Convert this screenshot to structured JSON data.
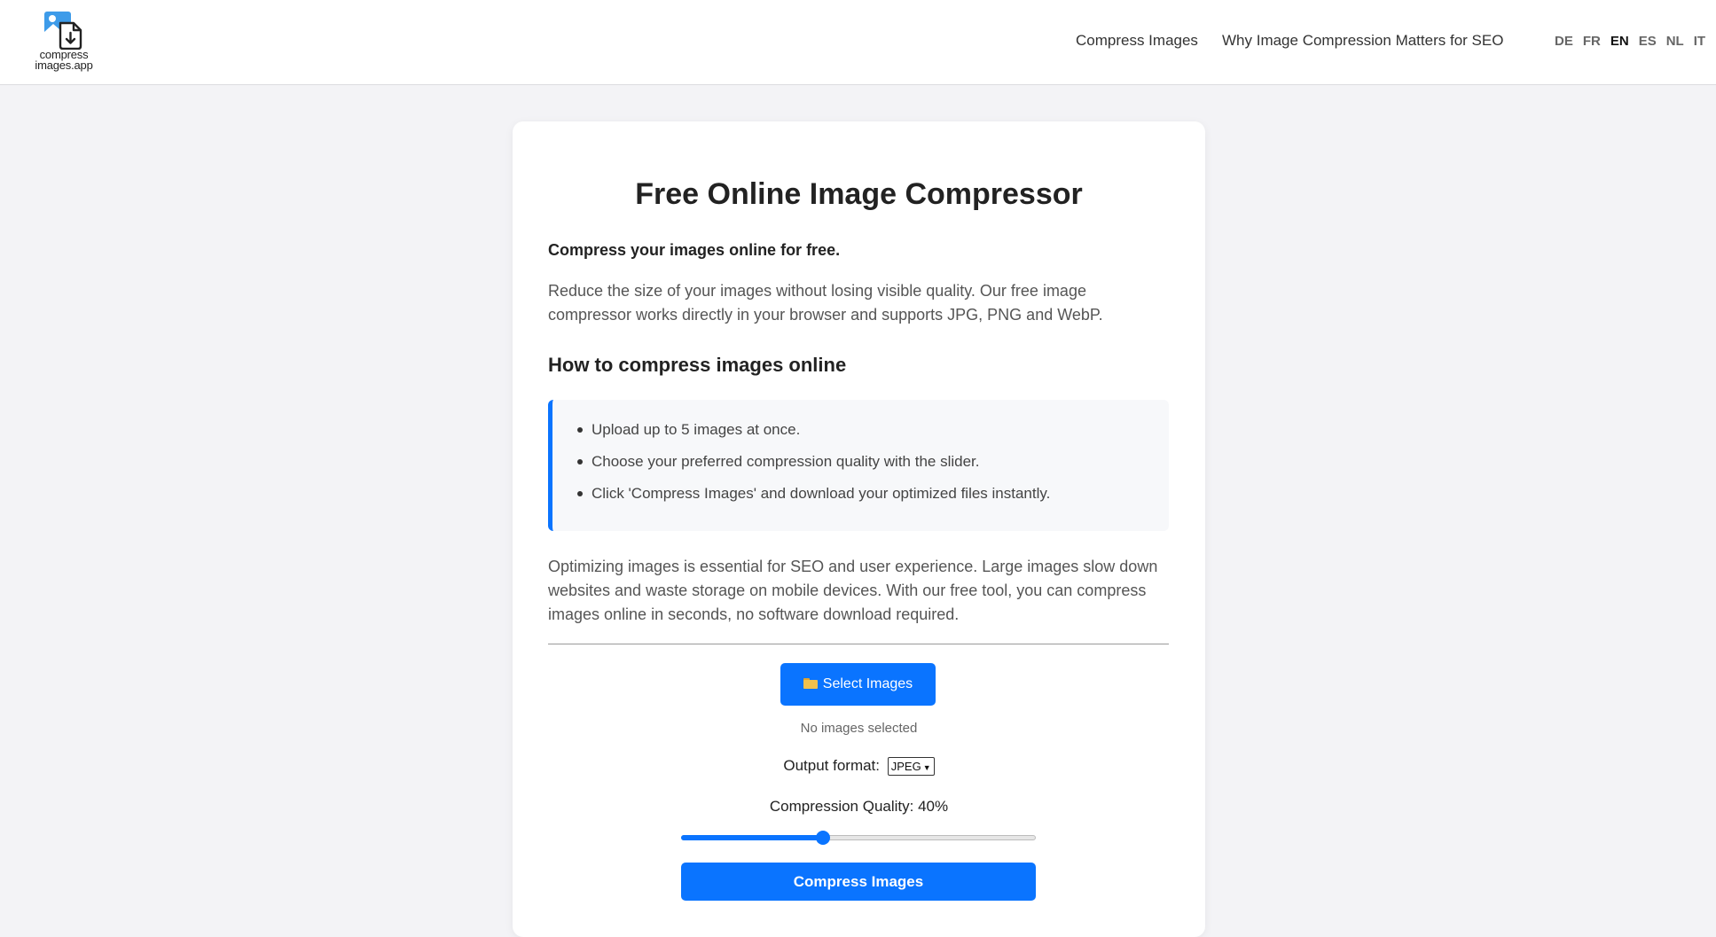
{
  "header": {
    "logo": {
      "line1": "compress",
      "line2": "images.app"
    },
    "nav": [
      {
        "label": "Compress Images"
      },
      {
        "label": "Why Image Compression Matters for SEO"
      }
    ],
    "languages": [
      {
        "code": "DE",
        "active": false
      },
      {
        "code": "FR",
        "active": false
      },
      {
        "code": "EN",
        "active": true
      },
      {
        "code": "ES",
        "active": false
      },
      {
        "code": "NL",
        "active": false
      },
      {
        "code": "IT",
        "active": false
      }
    ]
  },
  "main": {
    "title": "Free Online Image Compressor",
    "lead": "Compress your images online for free.",
    "description": "Reduce the size of your images without losing visible quality. Our free image compressor works directly in your browser and supports JPG, PNG and WebP.",
    "how_to_heading": "How to compress images online",
    "steps": [
      "Upload up to 5 images at once.",
      "Choose your preferred compression quality with the slider.",
      "Click 'Compress Images' and download your optimized files instantly."
    ],
    "seo_paragraph": "Optimizing images is essential for SEO and user experience. Large images slow down websites and waste storage on mobile devices. With our free tool, you can compress images online in seconds, no software download required."
  },
  "tool": {
    "select_button_label": "Select Images",
    "select_button_icon": "folder-icon",
    "status_text": "No images selected",
    "output_format_label": "Output format:",
    "output_format_value": "JPEG",
    "quality_label": "Compression Quality: 40%",
    "quality_value": 40,
    "quality_max": 100,
    "compress_button_label": "Compress Images"
  },
  "colors": {
    "accent": "#0a74ff",
    "page_background": "#f3f3f6",
    "card_background": "#ffffff",
    "folder": "#f2c14e"
  }
}
